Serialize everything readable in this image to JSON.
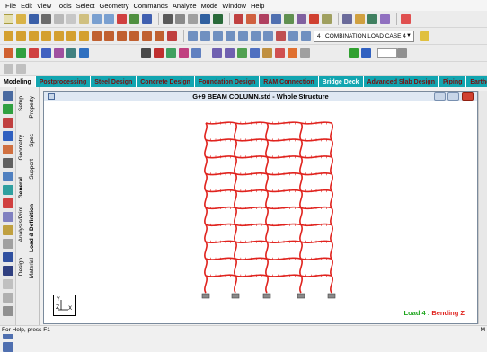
{
  "menu": [
    "File",
    "Edit",
    "View",
    "Tools",
    "Select",
    "Geometry",
    "Commands",
    "Analyze",
    "Mode",
    "Window",
    "Help"
  ],
  "toolbar": {
    "load_case": "4 : COMBINATION LOAD CASE 4"
  },
  "tabs": [
    {
      "label": "Modeling",
      "active": true
    },
    {
      "label": "Postprocessing",
      "active": false
    },
    {
      "label": "Steel Design",
      "active": false
    },
    {
      "label": "Concrete Design",
      "active": false
    },
    {
      "label": "Foundation Design",
      "active": false
    },
    {
      "label": "RAM Connection",
      "active": false
    },
    {
      "label": "Bridge Deck",
      "active": false
    },
    {
      "label": "Advanced Slab Design",
      "active": false
    },
    {
      "label": "Piping",
      "active": false
    },
    {
      "label": "Earthqu",
      "active": false
    }
  ],
  "side_tabs": {
    "setup": "Setup",
    "geometry": "Geometry",
    "general": "General",
    "analysis_print": "Analysis/Print",
    "design": "Design",
    "property": "Property",
    "spec": "Spec",
    "support": "Support",
    "load_definition": "Load & Definition",
    "material": "Material"
  },
  "viewport": {
    "title": "G+9 BEAM COLUMN.std - Whole Structure",
    "load_label_prefix": "Load 4 : ",
    "load_label_type": "Bending Z",
    "axis_y": "Y",
    "axis_z": "Z",
    "axis_x": "X"
  },
  "status": {
    "left": "For Help, press F1",
    "right": "M"
  },
  "colors": {
    "tab_bg": "#12a5b0",
    "tab_text": "#7a1010",
    "diagram_red": "#e0231e",
    "load_green": "#1ea51e"
  },
  "icons": [
    "new-file-icon",
    "open-icon",
    "save-icon",
    "print-icon",
    "cut-icon",
    "copy-icon",
    "paste-icon",
    "undo-icon",
    "redo-icon",
    "zoom-in-icon",
    "zoom-out-icon",
    "rotate-icon",
    "help-icon"
  ]
}
